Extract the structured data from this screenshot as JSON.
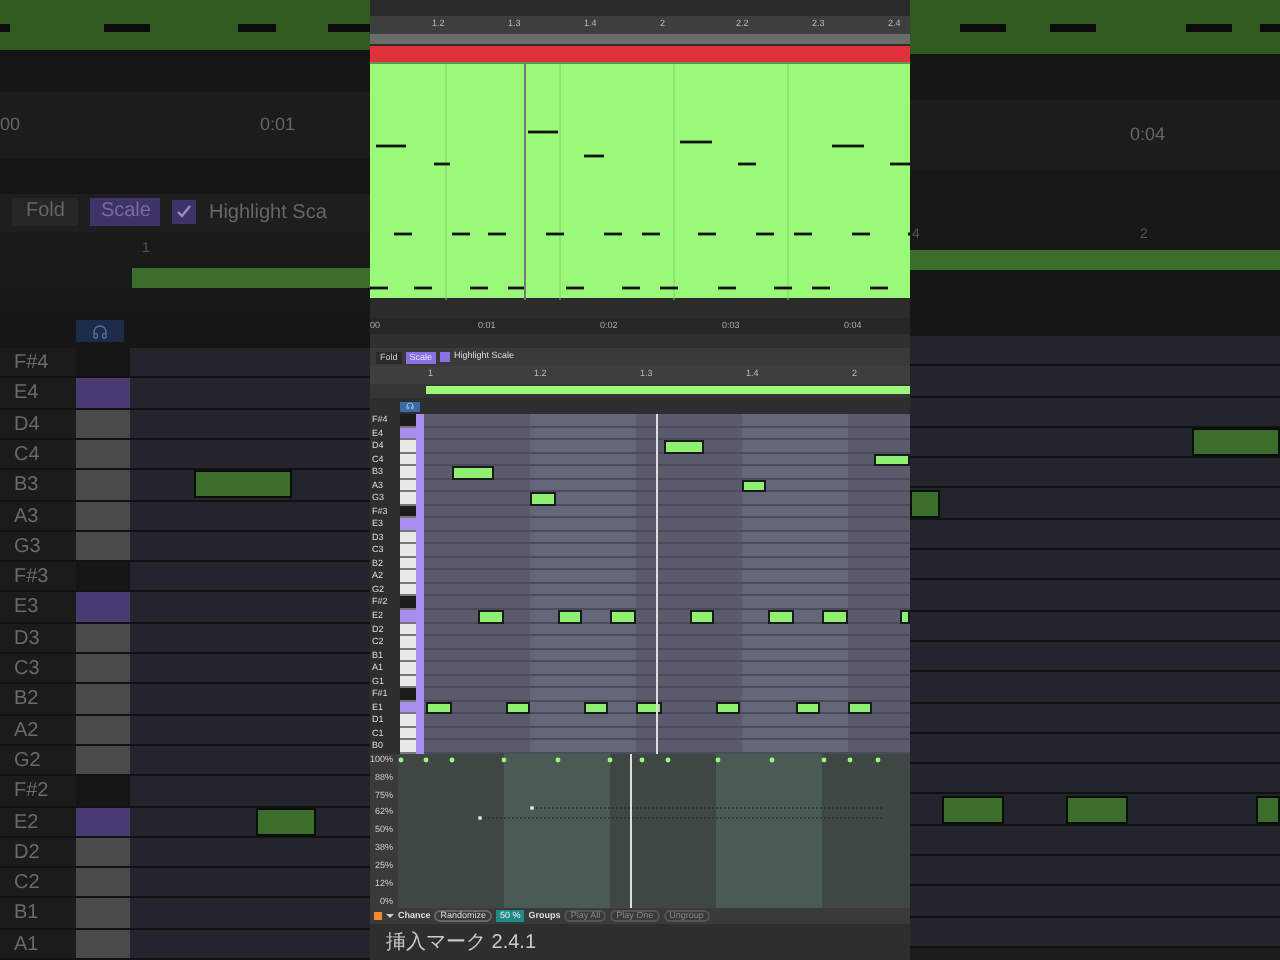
{
  "background_left": {
    "time_labels": [
      "00",
      "0:01"
    ],
    "fold": "Fold",
    "scale": {
      "label": "Scale",
      "on": true
    },
    "highlight_scale": {
      "label": "Highlight Sca",
      "checked": true
    },
    "ruler": [
      "1"
    ],
    "keys": [
      {
        "label": "F#4",
        "kind": "black"
      },
      {
        "label": "E4",
        "kind": "root"
      },
      {
        "label": "D4",
        "kind": "white"
      },
      {
        "label": "C4",
        "kind": "white"
      },
      {
        "label": "B3",
        "kind": "white"
      },
      {
        "label": "A3",
        "kind": "white"
      },
      {
        "label": "G3",
        "kind": "white"
      },
      {
        "label": "F#3",
        "kind": "black"
      },
      {
        "label": "E3",
        "kind": "root"
      },
      {
        "label": "D3",
        "kind": "white"
      },
      {
        "label": "C3",
        "kind": "white"
      },
      {
        "label": "B2",
        "kind": "white"
      },
      {
        "label": "A2",
        "kind": "white"
      },
      {
        "label": "G2",
        "kind": "white"
      },
      {
        "label": "F#2",
        "kind": "black"
      },
      {
        "label": "E2",
        "kind": "root"
      },
      {
        "label": "D2",
        "kind": "white"
      },
      {
        "label": "C2",
        "kind": "white"
      },
      {
        "label": "B1",
        "kind": "white"
      },
      {
        "label": "A1",
        "kind": "white"
      }
    ]
  },
  "background_right": {
    "time_labels": [
      "0:04"
    ],
    "ruler": [
      "4",
      "2"
    ]
  },
  "arrangement": {
    "bar_ruler": [
      "1.2",
      "1.3",
      "1.4",
      "2",
      "2.2",
      "2.3",
      "2.4"
    ],
    "time_ruler": [
      "00",
      "0:01",
      "0:02",
      "0:03",
      "0:04"
    ]
  },
  "piano_roll": {
    "fold": "Fold",
    "scale": {
      "label": "Scale",
      "on": true
    },
    "highlight_scale": {
      "label": "Highlight Scale",
      "checked": true
    },
    "ruler": [
      "1",
      "1.2",
      "1.3",
      "1.4",
      "2"
    ],
    "keys": [
      {
        "label": "F#4",
        "kind": "black"
      },
      {
        "label": "E4",
        "kind": "root"
      },
      {
        "label": "D4",
        "kind": "white"
      },
      {
        "label": "C4",
        "kind": "white"
      },
      {
        "label": "B3",
        "kind": "white"
      },
      {
        "label": "A3",
        "kind": "white"
      },
      {
        "label": "G3",
        "kind": "white"
      },
      {
        "label": "F#3",
        "kind": "black"
      },
      {
        "label": "E3",
        "kind": "root"
      },
      {
        "label": "D3",
        "kind": "white"
      },
      {
        "label": "C3",
        "kind": "white"
      },
      {
        "label": "B2",
        "kind": "white"
      },
      {
        "label": "A2",
        "kind": "white"
      },
      {
        "label": "G2",
        "kind": "white"
      },
      {
        "label": "F#2",
        "kind": "black"
      },
      {
        "label": "E2",
        "kind": "root"
      },
      {
        "label": "D2",
        "kind": "white"
      },
      {
        "label": "C2",
        "kind": "white"
      },
      {
        "label": "B1",
        "kind": "white"
      },
      {
        "label": "A1",
        "kind": "white"
      },
      {
        "label": "G1",
        "kind": "white"
      },
      {
        "label": "F#1",
        "kind": "black"
      },
      {
        "label": "E1",
        "kind": "root"
      },
      {
        "label": "D1",
        "kind": "white"
      },
      {
        "label": "C1",
        "kind": "white"
      },
      {
        "label": "B0",
        "kind": "white"
      }
    ]
  },
  "chance_lane": {
    "percent_labels": [
      "100%",
      "88%",
      "75%",
      "62%",
      "50%",
      "38%",
      "25%",
      "12%",
      "0%"
    ]
  },
  "bottom_bar": {
    "chance": "Chance",
    "randomize": "Randomize",
    "amount": "50 %",
    "groups": "Groups",
    "play_all": "Play All",
    "play_one": "Play One",
    "ungroup": "Ungroup"
  },
  "status_bar": "挿入マーク 2.4.1"
}
